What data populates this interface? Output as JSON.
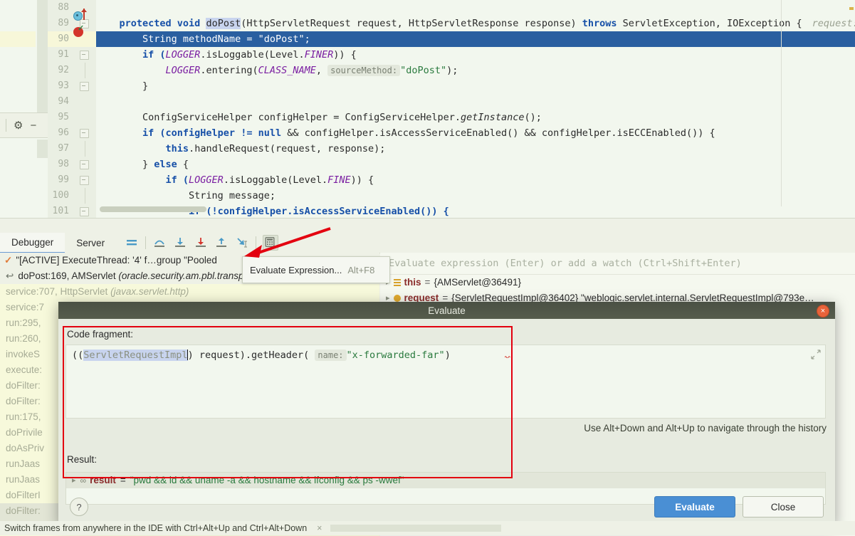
{
  "editor": {
    "lines": [
      {
        "num": "88",
        "fold": false,
        "text": "",
        "type": "blank"
      },
      {
        "num": "89",
        "fold": true,
        "type": "code89"
      },
      {
        "num": "90",
        "fold": false,
        "type": "code90",
        "highlight": true
      },
      {
        "num": "91",
        "fold": true,
        "type": "code91"
      },
      {
        "num": "92",
        "fold": false,
        "type": "code92"
      },
      {
        "num": "93",
        "fold": true,
        "type": "code93"
      },
      {
        "num": "94",
        "fold": false,
        "type": "blank"
      },
      {
        "num": "95",
        "fold": false,
        "type": "code95"
      },
      {
        "num": "96",
        "fold": true,
        "type": "code96"
      },
      {
        "num": "97",
        "fold": false,
        "type": "code97"
      },
      {
        "num": "98",
        "fold": true,
        "type": "code98"
      },
      {
        "num": "99",
        "fold": true,
        "type": "code99"
      },
      {
        "num": "100",
        "fold": false,
        "type": "code100"
      },
      {
        "num": "101",
        "fold": true,
        "type": "code101"
      }
    ],
    "code": {
      "l89_a": "    protected void ",
      "l89_method": "doPost",
      "l89_b": "(HttpServletRequest request, HttpServletResponse response) ",
      "l89_throws": "throws",
      "l89_c": " ServletException, IOException {",
      "l89_param_hint": "request:",
      "l90": "        String methodName = \"doPost\";",
      "l90_str": "\"doPost\"",
      "l91_a": "        if (",
      "l91_logger": "LOGGER",
      "l91_b": ".isLoggable(Level.",
      "l91_finer": "FINER",
      "l91_c": ")) {",
      "l92_a": "            ",
      "l92_logger": "LOGGER",
      "l92_b": ".entering(",
      "l92_class": "CLASS_NAME",
      "l92_c": ", ",
      "l92_hint": "sourceMethod:",
      "l92_str": "\"doPost\"",
      "l92_d": ");",
      "l93": "        }",
      "l95_a": "        ConfigServiceHelper configHelper = ConfigServiceHelper.",
      "l95_getinst": "getInstance",
      "l95_b": "();",
      "l96_a": "        if (configHelper != ",
      "l96_null": "null",
      "l96_b": " && configHelper.isAccessServiceEnabled() && configHelper.isECCEnabled()) {",
      "l97_a": "            ",
      "l97_this": "this",
      "l97_b": ".handleRequest(request, response);",
      "l98_a": "        } ",
      "l98_else": "else",
      "l98_b": " {",
      "l99_a": "            if (",
      "l99_logger": "LOGGER",
      "l99_b": ".isLoggable(Level.",
      "l99_fine": "FINE",
      "l99_c": ")) {",
      "l100": "                String message;",
      "l101_a": "                if (!configHelper.isAccessServiceEnabled()) {"
    }
  },
  "debugger": {
    "tabs": [
      {
        "label": "Debugger",
        "active": true
      },
      {
        "label": "Server",
        "active": false
      }
    ],
    "toolbar_icons": [
      "frames-list-icon",
      "step-over-icon",
      "step-into-icon",
      "force-step-into-icon",
      "step-out-icon",
      "run-to-cursor-icon",
      "evaluate-expression-icon"
    ],
    "tooltip": {
      "label": "Evaluate Expression...",
      "shortcut": "Alt+F8"
    },
    "thread": "\"[ACTIVE] ExecuteThread: '4' f…group \"Pooled",
    "frames": [
      {
        "text": "doPost:169, AMServlet ",
        "italic": "(oracle.security.am.pbl.transport.http)",
        "current": true
      },
      {
        "text": "service:707, HttpServlet ",
        "italic": "(javax.servlet.http)",
        "lib": true
      },
      {
        "text": "service:7",
        "italic": "",
        "lib": true
      },
      {
        "text": "run:295,",
        "italic": "",
        "lib": true
      },
      {
        "text": "run:260,",
        "italic": "",
        "lib": true
      },
      {
        "text": "invokeS",
        "italic": "",
        "lib": true
      },
      {
        "text": "execute:",
        "italic": "",
        "lib": true
      },
      {
        "text": "doFilter:",
        "italic": "",
        "lib": true
      },
      {
        "text": "doFilter:",
        "italic": "",
        "lib": true
      },
      {
        "text": "run:175,",
        "italic": "",
        "lib": true
      },
      {
        "text": "doPrivile",
        "italic": "",
        "lib": true
      },
      {
        "text": "doAsPriv",
        "italic": "",
        "lib": true
      },
      {
        "text": "runJaas",
        "italic": "",
        "lib": true
      },
      {
        "text": "runJaas",
        "italic": "",
        "lib": true
      },
      {
        "text": "doFilterI",
        "italic": "",
        "lib": true
      },
      {
        "text": "doFilter:",
        "italic": "",
        "lib": true,
        "selected": true
      }
    ],
    "watch_placeholder": "Evaluate expression (Enter) or add a watch (Ctrl+Shift+Enter)",
    "watch_rows": [
      {
        "name": "this",
        "eq": "=",
        "value": "{AMServlet@36491}"
      },
      {
        "name": "request",
        "eq": "=",
        "value": "{ServletRequestImpl@36402} \"weblogic.servlet.internal.ServletRequestImpl@793e…"
      }
    ]
  },
  "dialog": {
    "title": "Evaluate",
    "close_label": "×",
    "code_fragment_label": "Code fragment:",
    "code_fragment": {
      "prefix": "((",
      "cast_type": "ServletRequestImpl",
      "mid": ") request).getHeader( ",
      "param_hint": "name:",
      "arg": "\"x-forwarded-far\"",
      "suffix": ")"
    },
    "history_hint": "Use Alt+Down and Alt+Up to navigate through the history",
    "result_label": "Result:",
    "result": {
      "name": "result",
      "eq": "=",
      "value": "\"pwd && id && uname -a && hostname && ifconfig && ps -wwef\""
    },
    "help_label": "?",
    "evaluate_label": "Evaluate",
    "close_button_label": "Close"
  },
  "status": {
    "text": "Switch frames from anywhere in the IDE with Ctrl+Alt+Up and Ctrl+Alt+Down",
    "close": "×"
  },
  "colors": {
    "accent_blue": "#4a8fd4",
    "highlight_row": "#2a5fa0",
    "red_annotation": "#e3000f",
    "string_green": "#2a7a3e",
    "keyword_blue": "#1750a8",
    "name_red": "#8a2c2b"
  }
}
